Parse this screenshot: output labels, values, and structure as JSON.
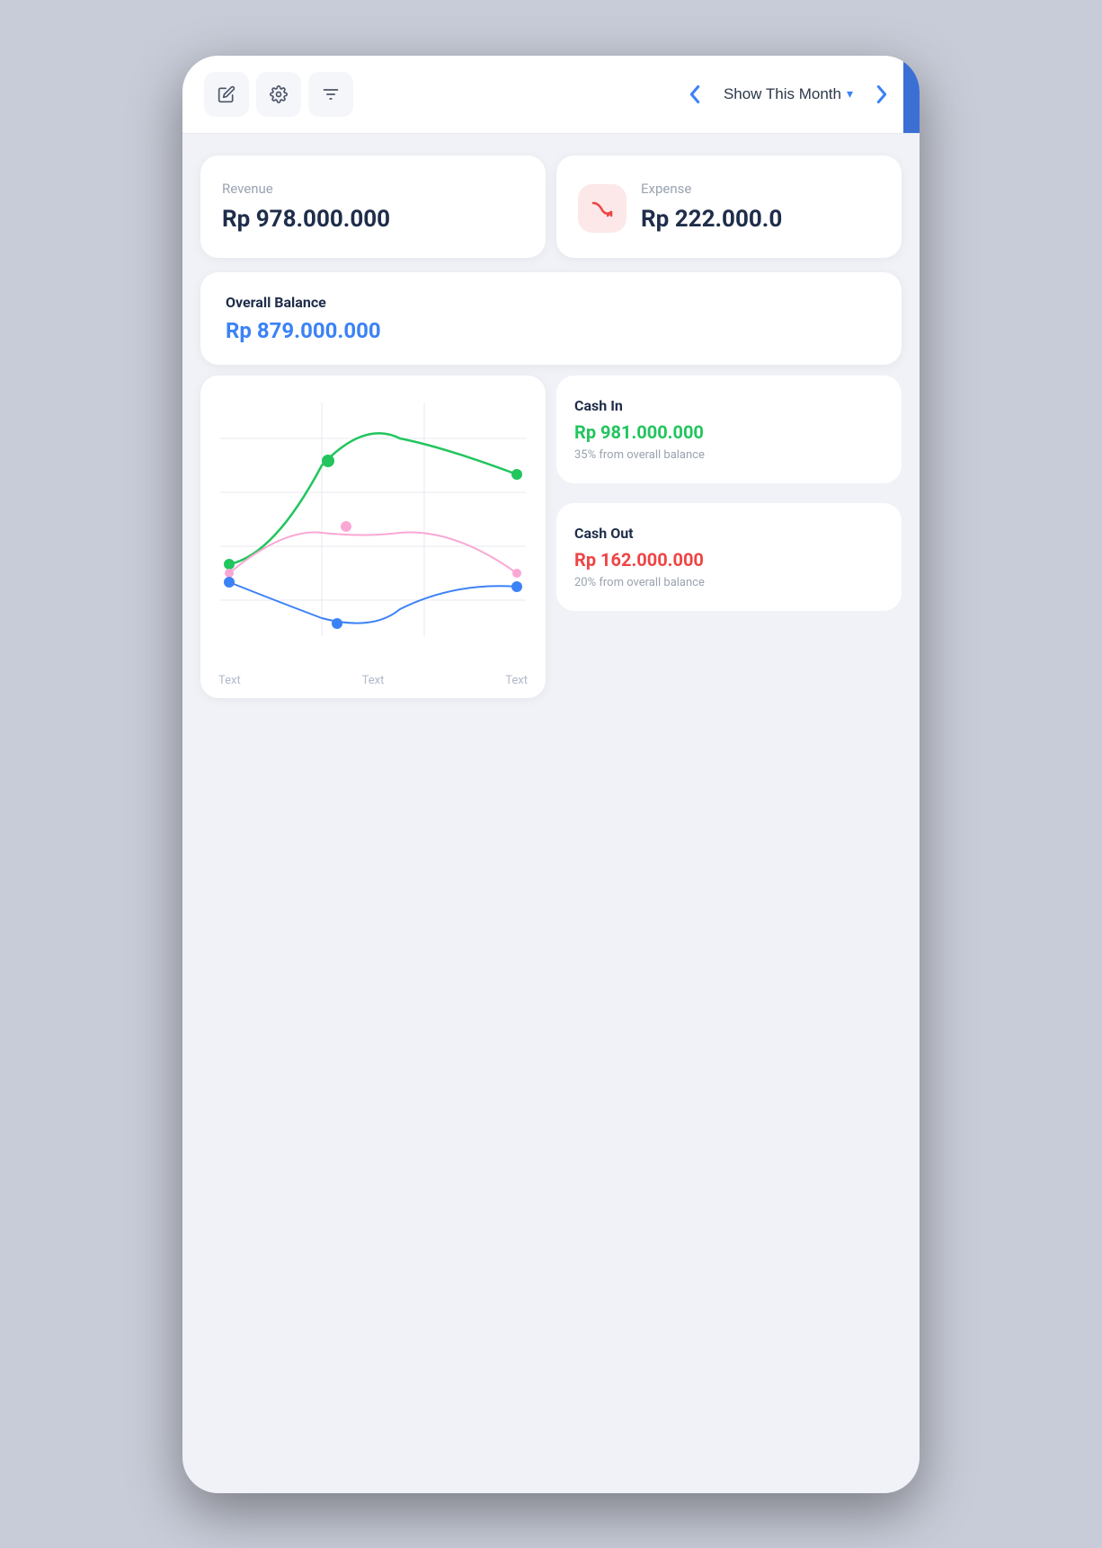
{
  "toolbar": {
    "edit_label": "✏",
    "settings_label": "⚙",
    "filter_label": "≡",
    "nav_left": "‹",
    "nav_right": "›",
    "month_selector": "Show This Month",
    "chevron": "▾"
  },
  "revenue": {
    "label": "Revenue",
    "value": "Rp 978.000.000"
  },
  "expense": {
    "label": "Expense",
    "value": "Rp 222.000.0"
  },
  "overall_balance": {
    "label": "Overall Balance",
    "value": "Rp 879.000.000"
  },
  "cash_in": {
    "label": "Cash In",
    "value": "Rp 981.000.000",
    "sub": "35% from overall balance"
  },
  "cash_out": {
    "label": "Cash Out",
    "value": "Rp 162.000.000",
    "sub": "20% from overall balance"
  },
  "chart": {
    "x_labels": [
      "Text",
      "Text",
      "Text"
    ]
  },
  "colors": {
    "blue": "#3b82f6",
    "green": "#22c55e",
    "red": "#ef4444",
    "accent_blue": "#3b6fd4"
  }
}
